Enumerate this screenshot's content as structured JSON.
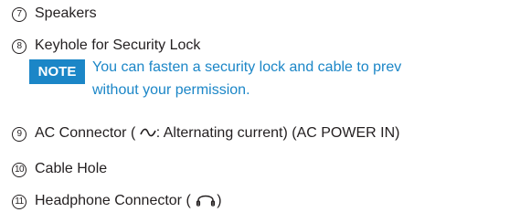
{
  "items": [
    {
      "number": "7",
      "label": "Speakers"
    },
    {
      "number": "8",
      "label": "Keyhole for Security Lock"
    },
    {
      "number": "9",
      "label_prefix": "AC Connector (",
      "label_suffix": ": Alternating current) (AC POWER IN)",
      "icon": "alternating-current-icon"
    },
    {
      "number": "10",
      "label": "Cable Hole"
    },
    {
      "number": "11",
      "label_prefix": "Headphone Connector (",
      "label_suffix": ")",
      "icon": "headphone-icon"
    }
  ],
  "note": {
    "badge": "NOTE",
    "line1": "You can fasten a security lock and cable to prev",
    "line2": "without your permission.",
    "color": "#1b86c7"
  }
}
